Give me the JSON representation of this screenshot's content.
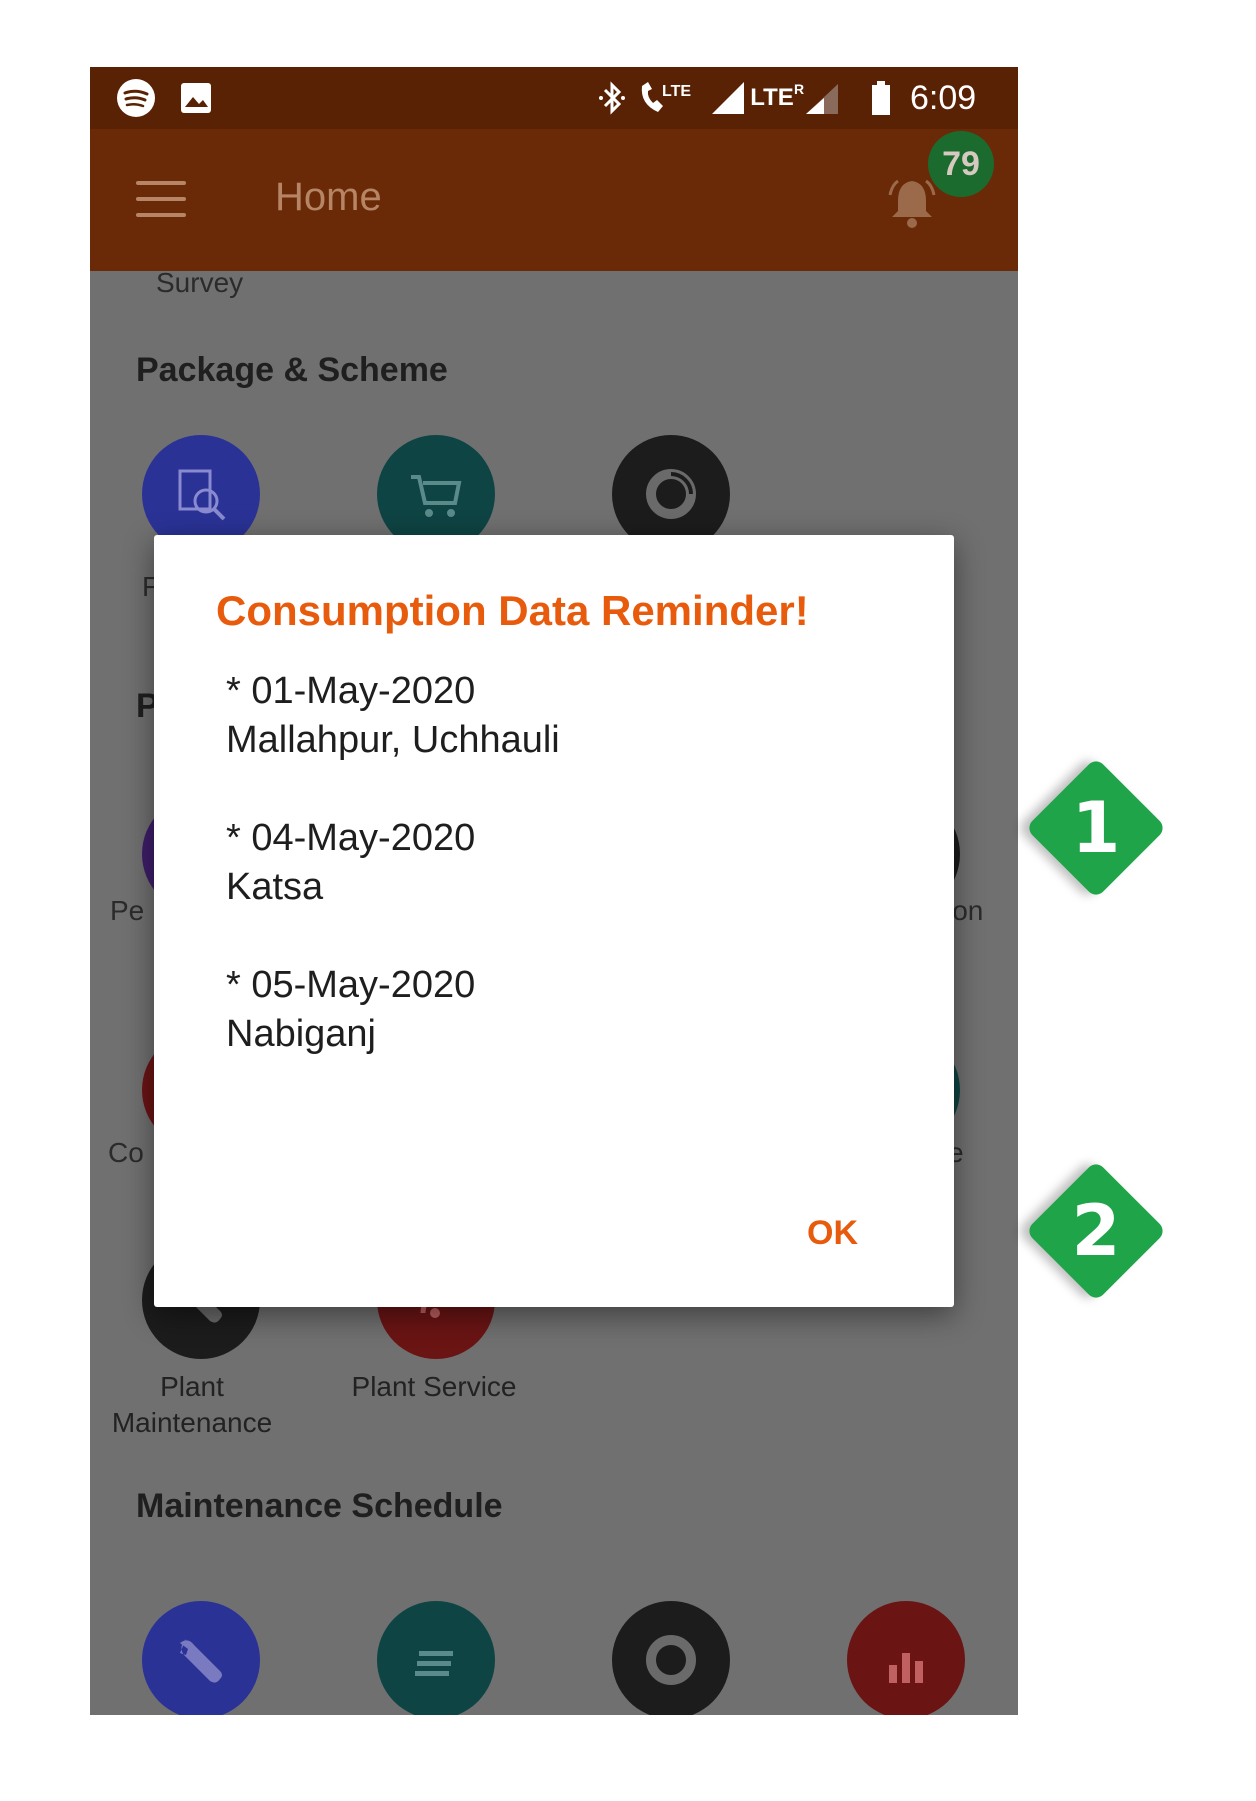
{
  "status_bar": {
    "time": "6:09",
    "network_label": "LTE",
    "roaming_label": "R",
    "icons": [
      "spotify-icon",
      "image-icon",
      "bluetooth-icon",
      "volte-call-icon",
      "signal-icon",
      "battery-icon"
    ]
  },
  "app_bar": {
    "title": "Home",
    "notification_count": "79"
  },
  "background": {
    "partial_label_top": "Survey",
    "section_package": "Package & Scheme",
    "section_maintenance": "Maintenance Schedule",
    "partial_labels": {
      "left_row2": "Pe",
      "right_row2": "ion",
      "left_row3": "Co",
      "right_row3": "e",
      "left_row1_a": "F",
      "left_row1_b": "/",
      "section_p": "P"
    },
    "plant_maintenance": "Plant\nMaintenance",
    "plant_service": "Plant Service"
  },
  "dialog": {
    "title": "Consumption Data Reminder!",
    "entries": [
      {
        "date": "* 01-May-2020",
        "place": "Mallahpur, Uchhauli"
      },
      {
        "date": "* 04-May-2020",
        "place": "Katsa"
      },
      {
        "date": "* 05-May-2020",
        "place": "Nabiganj"
      }
    ],
    "ok_label": "OK"
  },
  "callouts": [
    {
      "label": "1"
    },
    {
      "label": "2"
    }
  ],
  "colors": {
    "accent": "#e85b0c",
    "app_bar": "#6a2a08",
    "callout": "#1fa44a"
  }
}
